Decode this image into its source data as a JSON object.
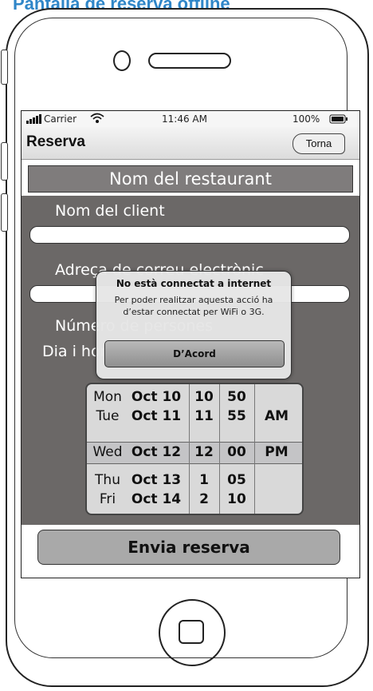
{
  "caption": "Pantalla de reserva offline",
  "status_bar": {
    "carrier": "Carrier",
    "time": "11:46 AM",
    "battery": "100%"
  },
  "nav": {
    "title": "Reserva",
    "back_label": "Torna"
  },
  "restaurant_name": "Nom del restaurant",
  "form": {
    "client_label": "Nom del client",
    "address_label": "Adreça de correu electrònic",
    "people_label": "Número de persones",
    "datetime_label": "Dia i hora"
  },
  "picker": {
    "rows": [
      {
        "day": "Mon",
        "date": "Oct 10",
        "hour": "10",
        "minute": "50",
        "ampm": ""
      },
      {
        "day": "Tue",
        "date": "Oct 11",
        "hour": "11",
        "minute": "55",
        "ampm": "AM"
      },
      {
        "day": "Wed",
        "date": "Oct 12",
        "hour": "12",
        "minute": "00",
        "ampm": "PM"
      },
      {
        "day": "Thu",
        "date": "Oct 13",
        "hour": "1",
        "minute": "05",
        "ampm": ""
      },
      {
        "day": "Fri",
        "date": "Oct 14",
        "hour": "2",
        "minute": "10",
        "ampm": ""
      }
    ]
  },
  "submit_label": "Envia reserva",
  "alert": {
    "title": "No està connectat a internet",
    "message": "Per poder realitzar aquesta acció ha d’estar connectat per WiFi o 3G.",
    "button": "D’Acord"
  },
  "colors": {
    "accent": "#2f86c8",
    "panel": "#6b6867",
    "header_bar": "#7f7c7c"
  }
}
